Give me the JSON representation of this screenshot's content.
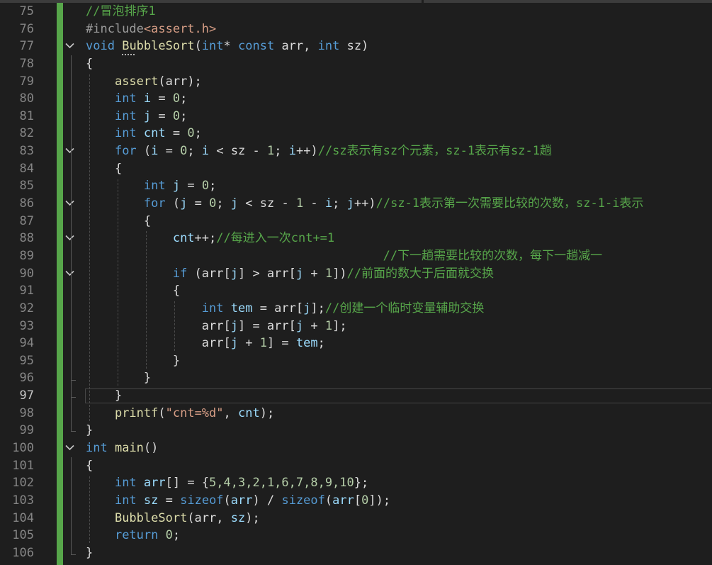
{
  "editor": {
    "active_line": 97,
    "colors": {
      "background": "#1e1e1e",
      "keyword": "#569cd6",
      "comment": "#57a64a",
      "string": "#d69d85",
      "number": "#b5cea8",
      "function": "#dcdcaa",
      "preprocessor": "#9b9b9b",
      "variable": "#9cdcfe",
      "plain": "#dcdcdc",
      "change_bar": "#57a64a"
    },
    "fold_icon": "chevron-down-icon",
    "lines": [
      {
        "num": "75",
        "fold": false,
        "segs": [
          {
            "t": "//冒泡排序1",
            "c": "comment"
          }
        ]
      },
      {
        "num": "76",
        "fold": false,
        "segs": [
          {
            "t": "#include",
            "c": "preprocessor"
          },
          {
            "t": "<assert.h>",
            "c": "string"
          }
        ]
      },
      {
        "num": "77",
        "fold": true,
        "segs": [
          {
            "t": "void",
            "c": "keyword"
          },
          {
            "t": " ",
            "c": "plain"
          },
          {
            "t": "BubbleSort",
            "c": "function"
          },
          {
            "t": "(",
            "c": "plain"
          },
          {
            "t": "int",
            "c": "keyword"
          },
          {
            "t": "* ",
            "c": "plain"
          },
          {
            "t": "const",
            "c": "keyword"
          },
          {
            "t": " arr, ",
            "c": "plain"
          },
          {
            "t": "int",
            "c": "keyword"
          },
          {
            "t": " sz)",
            "c": "plain"
          }
        ]
      },
      {
        "num": "78",
        "fold": false,
        "segs": [
          {
            "t": "{",
            "c": "plain"
          }
        ]
      },
      {
        "num": "79",
        "fold": false,
        "segs": [
          {
            "t": "    ",
            "c": "plain"
          },
          {
            "t": "assert",
            "c": "function"
          },
          {
            "t": "(arr);",
            "c": "plain"
          }
        ]
      },
      {
        "num": "80",
        "fold": false,
        "segs": [
          {
            "t": "    ",
            "c": "plain"
          },
          {
            "t": "int",
            "c": "keyword"
          },
          {
            "t": " ",
            "c": "plain"
          },
          {
            "t": "i",
            "c": "variable"
          },
          {
            "t": " = ",
            "c": "plain"
          },
          {
            "t": "0",
            "c": "number"
          },
          {
            "t": ";",
            "c": "plain"
          }
        ]
      },
      {
        "num": "81",
        "fold": false,
        "segs": [
          {
            "t": "    ",
            "c": "plain"
          },
          {
            "t": "int",
            "c": "keyword"
          },
          {
            "t": " ",
            "c": "plain"
          },
          {
            "t": "j",
            "c": "variable"
          },
          {
            "t": " = ",
            "c": "plain"
          },
          {
            "t": "0",
            "c": "number"
          },
          {
            "t": ";",
            "c": "plain"
          }
        ]
      },
      {
        "num": "82",
        "fold": false,
        "segs": [
          {
            "t": "    ",
            "c": "plain"
          },
          {
            "t": "int",
            "c": "keyword"
          },
          {
            "t": " ",
            "c": "plain"
          },
          {
            "t": "cnt",
            "c": "variable"
          },
          {
            "t": " = ",
            "c": "plain"
          },
          {
            "t": "0",
            "c": "number"
          },
          {
            "t": ";",
            "c": "plain"
          }
        ]
      },
      {
        "num": "83",
        "fold": true,
        "segs": [
          {
            "t": "    ",
            "c": "plain"
          },
          {
            "t": "for",
            "c": "keyword"
          },
          {
            "t": " (",
            "c": "plain"
          },
          {
            "t": "i",
            "c": "variable"
          },
          {
            "t": " = ",
            "c": "plain"
          },
          {
            "t": "0",
            "c": "number"
          },
          {
            "t": "; ",
            "c": "plain"
          },
          {
            "t": "i",
            "c": "variable"
          },
          {
            "t": " < sz - ",
            "c": "plain"
          },
          {
            "t": "1",
            "c": "number"
          },
          {
            "t": "; ",
            "c": "plain"
          },
          {
            "t": "i",
            "c": "variable"
          },
          {
            "t": "++)",
            "c": "plain"
          },
          {
            "t": "//sz表示有sz个元素，sz-1表示有sz-1趟",
            "c": "comment"
          }
        ]
      },
      {
        "num": "84",
        "fold": false,
        "segs": [
          {
            "t": "    {",
            "c": "plain"
          }
        ]
      },
      {
        "num": "85",
        "fold": false,
        "segs": [
          {
            "t": "        ",
            "c": "plain"
          },
          {
            "t": "int",
            "c": "keyword"
          },
          {
            "t": " ",
            "c": "plain"
          },
          {
            "t": "j",
            "c": "variable"
          },
          {
            "t": " = ",
            "c": "plain"
          },
          {
            "t": "0",
            "c": "number"
          },
          {
            "t": ";",
            "c": "plain"
          }
        ]
      },
      {
        "num": "86",
        "fold": true,
        "segs": [
          {
            "t": "        ",
            "c": "plain"
          },
          {
            "t": "for",
            "c": "keyword"
          },
          {
            "t": " (",
            "c": "plain"
          },
          {
            "t": "j",
            "c": "variable"
          },
          {
            "t": " = ",
            "c": "plain"
          },
          {
            "t": "0",
            "c": "number"
          },
          {
            "t": "; ",
            "c": "plain"
          },
          {
            "t": "j",
            "c": "variable"
          },
          {
            "t": " < sz - ",
            "c": "plain"
          },
          {
            "t": "1",
            "c": "number"
          },
          {
            "t": " - ",
            "c": "plain"
          },
          {
            "t": "i",
            "c": "variable"
          },
          {
            "t": "; ",
            "c": "plain"
          },
          {
            "t": "j",
            "c": "variable"
          },
          {
            "t": "++)",
            "c": "plain"
          },
          {
            "t": "//sz-1表示第一次需要比较的次数，sz-1-i表示",
            "c": "comment"
          }
        ]
      },
      {
        "num": "87",
        "fold": false,
        "segs": [
          {
            "t": "        {",
            "c": "plain"
          }
        ]
      },
      {
        "num": "88",
        "fold": true,
        "segs": [
          {
            "t": "            ",
            "c": "plain"
          },
          {
            "t": "cnt",
            "c": "variable"
          },
          {
            "t": "++;",
            "c": "plain"
          },
          {
            "t": "//每进入一次cnt+=1",
            "c": "comment"
          }
        ]
      },
      {
        "num": "89",
        "fold": false,
        "segs": [
          {
            "t": "                                         ",
            "c": "plain"
          },
          {
            "t": "//下一趟需要比较的次数，每下一趟减一",
            "c": "comment"
          }
        ]
      },
      {
        "num": "90",
        "fold": true,
        "segs": [
          {
            "t": "            ",
            "c": "plain"
          },
          {
            "t": "if",
            "c": "keyword"
          },
          {
            "t": " (arr[",
            "c": "plain"
          },
          {
            "t": "j",
            "c": "variable"
          },
          {
            "t": "] > arr[",
            "c": "plain"
          },
          {
            "t": "j",
            "c": "variable"
          },
          {
            "t": " + ",
            "c": "plain"
          },
          {
            "t": "1",
            "c": "number"
          },
          {
            "t": "])",
            "c": "plain"
          },
          {
            "t": "//前面的数大于后面就交换",
            "c": "comment"
          }
        ]
      },
      {
        "num": "91",
        "fold": false,
        "segs": [
          {
            "t": "            {",
            "c": "plain"
          }
        ]
      },
      {
        "num": "92",
        "fold": false,
        "segs": [
          {
            "t": "                ",
            "c": "plain"
          },
          {
            "t": "int",
            "c": "keyword"
          },
          {
            "t": " ",
            "c": "plain"
          },
          {
            "t": "tem",
            "c": "variable"
          },
          {
            "t": " = arr[",
            "c": "plain"
          },
          {
            "t": "j",
            "c": "variable"
          },
          {
            "t": "];",
            "c": "plain"
          },
          {
            "t": "//创建一个临时变量辅助交换",
            "c": "comment"
          }
        ]
      },
      {
        "num": "93",
        "fold": false,
        "segs": [
          {
            "t": "                ",
            "c": "plain"
          },
          {
            "t": "arr[",
            "c": "plain"
          },
          {
            "t": "j",
            "c": "variable"
          },
          {
            "t": "] = arr[",
            "c": "plain"
          },
          {
            "t": "j",
            "c": "variable"
          },
          {
            "t": " + ",
            "c": "plain"
          },
          {
            "t": "1",
            "c": "number"
          },
          {
            "t": "];",
            "c": "plain"
          }
        ]
      },
      {
        "num": "94",
        "fold": false,
        "segs": [
          {
            "t": "                ",
            "c": "plain"
          },
          {
            "t": "arr[",
            "c": "plain"
          },
          {
            "t": "j",
            "c": "variable"
          },
          {
            "t": " + ",
            "c": "plain"
          },
          {
            "t": "1",
            "c": "number"
          },
          {
            "t": "] = ",
            "c": "plain"
          },
          {
            "t": "tem",
            "c": "variable"
          },
          {
            "t": ";",
            "c": "plain"
          }
        ]
      },
      {
        "num": "95",
        "fold": false,
        "segs": [
          {
            "t": "            }",
            "c": "plain"
          }
        ]
      },
      {
        "num": "96",
        "fold": false,
        "segs": [
          {
            "t": "        }",
            "c": "plain"
          }
        ]
      },
      {
        "num": "97",
        "fold": false,
        "segs": [
          {
            "t": "    }",
            "c": "plain"
          }
        ]
      },
      {
        "num": "98",
        "fold": false,
        "segs": [
          {
            "t": "    ",
            "c": "plain"
          },
          {
            "t": "printf",
            "c": "function"
          },
          {
            "t": "(",
            "c": "plain"
          },
          {
            "t": "\"cnt=%d\"",
            "c": "string"
          },
          {
            "t": ", ",
            "c": "plain"
          },
          {
            "t": "cnt",
            "c": "variable"
          },
          {
            "t": ");",
            "c": "plain"
          }
        ]
      },
      {
        "num": "99",
        "fold": false,
        "segs": [
          {
            "t": "}",
            "c": "plain"
          }
        ]
      },
      {
        "num": "100",
        "fold": true,
        "segs": [
          {
            "t": "int",
            "c": "keyword"
          },
          {
            "t": " ",
            "c": "plain"
          },
          {
            "t": "main",
            "c": "function"
          },
          {
            "t": "()",
            "c": "plain"
          }
        ]
      },
      {
        "num": "101",
        "fold": false,
        "segs": [
          {
            "t": "{",
            "c": "plain"
          }
        ]
      },
      {
        "num": "102",
        "fold": false,
        "segs": [
          {
            "t": "    ",
            "c": "plain"
          },
          {
            "t": "int",
            "c": "keyword"
          },
          {
            "t": " ",
            "c": "plain"
          },
          {
            "t": "arr",
            "c": "variable"
          },
          {
            "t": "[] = {",
            "c": "plain"
          },
          {
            "t": "5,4,3,2,1,6,7,8,9,10",
            "c": "number"
          },
          {
            "t": "};",
            "c": "plain"
          }
        ]
      },
      {
        "num": "103",
        "fold": false,
        "segs": [
          {
            "t": "    ",
            "c": "plain"
          },
          {
            "t": "int",
            "c": "keyword"
          },
          {
            "t": " ",
            "c": "plain"
          },
          {
            "t": "sz",
            "c": "variable"
          },
          {
            "t": " = ",
            "c": "plain"
          },
          {
            "t": "sizeof",
            "c": "keyword"
          },
          {
            "t": "(",
            "c": "plain"
          },
          {
            "t": "arr",
            "c": "variable"
          },
          {
            "t": ") / ",
            "c": "plain"
          },
          {
            "t": "sizeof",
            "c": "keyword"
          },
          {
            "t": "(",
            "c": "plain"
          },
          {
            "t": "arr",
            "c": "variable"
          },
          {
            "t": "[",
            "c": "plain"
          },
          {
            "t": "0",
            "c": "number"
          },
          {
            "t": "]);",
            "c": "plain"
          }
        ]
      },
      {
        "num": "104",
        "fold": false,
        "segs": [
          {
            "t": "    ",
            "c": "plain"
          },
          {
            "t": "BubbleSort",
            "c": "function"
          },
          {
            "t": "(arr, ",
            "c": "plain"
          },
          {
            "t": "sz",
            "c": "variable"
          },
          {
            "t": ");",
            "c": "plain"
          }
        ]
      },
      {
        "num": "105",
        "fold": false,
        "segs": [
          {
            "t": "    ",
            "c": "plain"
          },
          {
            "t": "return",
            "c": "keyword"
          },
          {
            "t": " ",
            "c": "plain"
          },
          {
            "t": "0",
            "c": "number"
          },
          {
            "t": ";",
            "c": "plain"
          }
        ]
      },
      {
        "num": "106",
        "fold": false,
        "segs": [
          {
            "t": "}",
            "c": "plain"
          }
        ]
      }
    ]
  }
}
